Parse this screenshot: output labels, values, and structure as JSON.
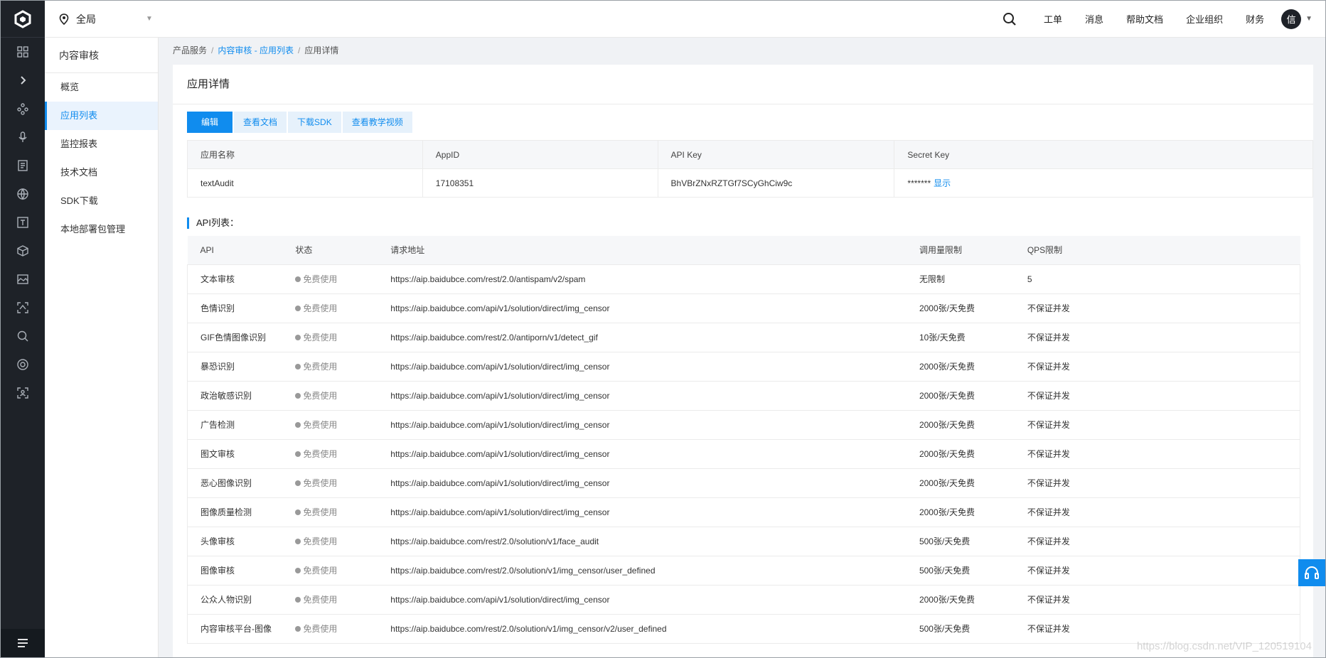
{
  "topbar": {
    "region": "全局",
    "links": [
      "工单",
      "消息",
      "帮助文档",
      "企业组织",
      "财务"
    ],
    "avatar": "信"
  },
  "sidebar": {
    "title": "内容审核",
    "items": [
      {
        "label": "概览"
      },
      {
        "label": "应用列表",
        "active": true
      },
      {
        "label": "监控报表"
      },
      {
        "label": "技术文档"
      },
      {
        "label": "SDK下载"
      },
      {
        "label": "本地部署包管理"
      }
    ]
  },
  "breadcrumb": {
    "root": "产品服务",
    "link": "内容审核 - 应用列表",
    "current": "应用详情"
  },
  "page": {
    "title": "应用详情",
    "buttons": [
      "编辑",
      "查看文档",
      "下载SDK",
      "查看教学视频"
    ]
  },
  "app_info": {
    "headers": [
      "应用名称",
      "AppID",
      "API Key",
      "Secret Key"
    ],
    "name": "textAudit",
    "appid": "17108351",
    "api_key": "BhVBrZNxRZTGf7SCyGhCiw9c",
    "secret_mask": "*******",
    "show_label": "显示"
  },
  "api_list": {
    "title": "API列表：",
    "headers": [
      "API",
      "状态",
      "请求地址",
      "调用量限制",
      "QPS限制"
    ],
    "rows": [
      {
        "api": "文本审核",
        "status": "免费使用",
        "url": "https://aip.baidubce.com/rest/2.0/antispam/v2/spam",
        "limit": "无限制",
        "qps": "5"
      },
      {
        "api": "色情识别",
        "status": "免费使用",
        "url": "https://aip.baidubce.com/api/v1/solution/direct/img_censor",
        "limit": "2000张/天免费",
        "qps": "不保证并发"
      },
      {
        "api": "GIF色情图像识别",
        "status": "免费使用",
        "url": "https://aip.baidubce.com/rest/2.0/antiporn/v1/detect_gif",
        "limit": "10张/天免费",
        "qps": "不保证并发"
      },
      {
        "api": "暴恐识别",
        "status": "免费使用",
        "url": "https://aip.baidubce.com/api/v1/solution/direct/img_censor",
        "limit": "2000张/天免费",
        "qps": "不保证并发"
      },
      {
        "api": "政治敏感识别",
        "status": "免费使用",
        "url": "https://aip.baidubce.com/api/v1/solution/direct/img_censor",
        "limit": "2000张/天免费",
        "qps": "不保证并发"
      },
      {
        "api": "广告检测",
        "status": "免费使用",
        "url": "https://aip.baidubce.com/api/v1/solution/direct/img_censor",
        "limit": "2000张/天免费",
        "qps": "不保证并发"
      },
      {
        "api": "图文审核",
        "status": "免费使用",
        "url": "https://aip.baidubce.com/api/v1/solution/direct/img_censor",
        "limit": "2000张/天免费",
        "qps": "不保证并发"
      },
      {
        "api": "恶心图像识别",
        "status": "免费使用",
        "url": "https://aip.baidubce.com/api/v1/solution/direct/img_censor",
        "limit": "2000张/天免费",
        "qps": "不保证并发"
      },
      {
        "api": "图像质量检测",
        "status": "免费使用",
        "url": "https://aip.baidubce.com/api/v1/solution/direct/img_censor",
        "limit": "2000张/天免费",
        "qps": "不保证并发"
      },
      {
        "api": "头像审核",
        "status": "免费使用",
        "url": "https://aip.baidubce.com/rest/2.0/solution/v1/face_audit",
        "limit": "500张/天免费",
        "qps": "不保证并发"
      },
      {
        "api": "图像审核",
        "status": "免费使用",
        "url": "https://aip.baidubce.com/rest/2.0/solution/v1/img_censor/user_defined",
        "limit": "500张/天免费",
        "qps": "不保证并发"
      },
      {
        "api": "公众人物识别",
        "status": "免费使用",
        "url": "https://aip.baidubce.com/api/v1/solution/direct/img_censor",
        "limit": "2000张/天免费",
        "qps": "不保证并发"
      },
      {
        "api": "内容审核平台-图像",
        "status": "免费使用",
        "url": "https://aip.baidubce.com/rest/2.0/solution/v1/img_censor/v2/user_defined",
        "limit": "500张/天免费",
        "qps": "不保证并发"
      }
    ]
  },
  "watermark": "https://blog.csdn.net/VIP_120519104",
  "colors": {
    "accent": "#108cee",
    "rail": "#1e2228"
  }
}
